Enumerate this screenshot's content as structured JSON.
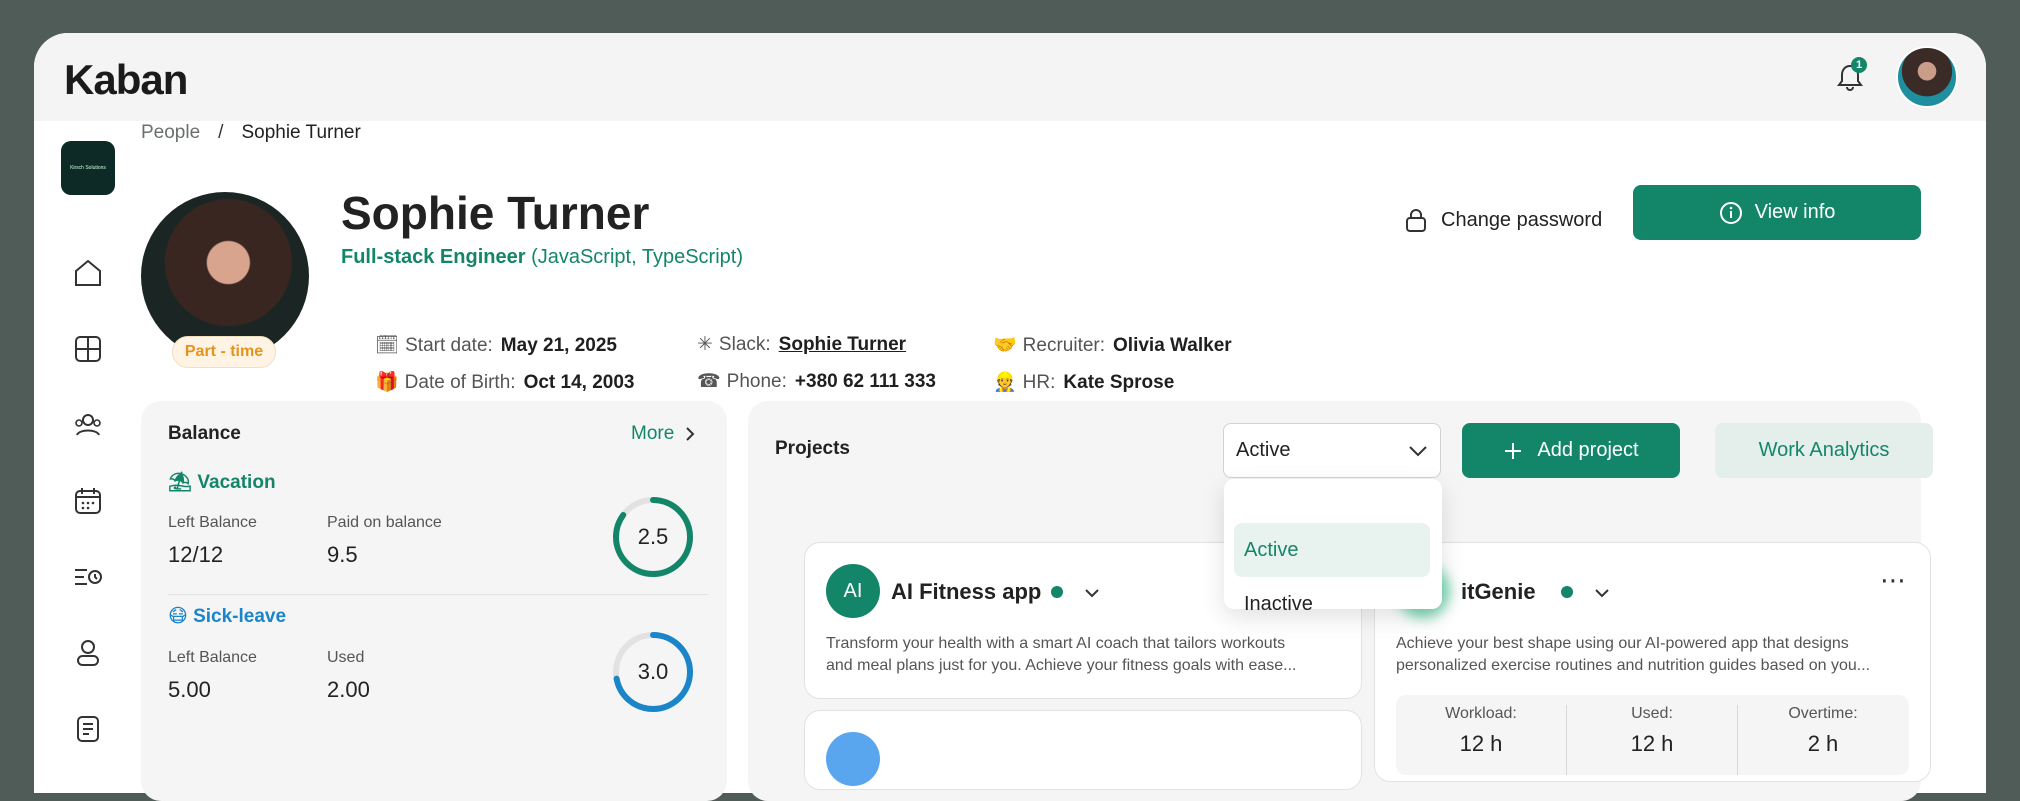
{
  "app": {
    "logo": "Kaban",
    "notifications_count": "1"
  },
  "breadcrumb": {
    "parent": "People",
    "separator": "/",
    "current": "Sophie Turner"
  },
  "profile": {
    "name": "Sophie Turner",
    "role_main": "Full-stack Engineer",
    "role_sub": "(JavaScript, TypeScript)",
    "employment_badge": "Part - time",
    "start_date_label": "Start date:",
    "start_date": "May 21, 2025",
    "dob_label": "Date of Birth:",
    "dob": "Oct 14, 2003",
    "slack_label": "Slack:",
    "slack": "Sophie Turner",
    "phone_label": "Phone:",
    "phone": "+380 62 111 333",
    "recruiter_label": "Recruiter:",
    "recruiter": "Olivia Walker",
    "hr_label": "HR:",
    "hr": "Kate Sprose"
  },
  "actions": {
    "change_password": "Change password",
    "view_info": "View info"
  },
  "balance": {
    "title": "Balance",
    "more": "More",
    "vacation": {
      "title": "Vacation",
      "left_label": "Left Balance",
      "left_value": "12/12",
      "paid_label": "Paid on balance",
      "paid_value": "9.5",
      "ring_value": "2.5",
      "ring_fraction": 0.85
    },
    "sick_leave": {
      "title": "Sick-leave",
      "left_label": "Left Balance",
      "left_value": "5.00",
      "used_label": "Used",
      "used_value": "2.00",
      "ring_value": "3.0",
      "ring_fraction": 0.72
    }
  },
  "projects": {
    "title": "Projects",
    "filter_value": "Active",
    "filter_options": [
      "Active",
      "Inactive"
    ],
    "add_label": "Add project",
    "analytics_label": "Work Analytics",
    "cards": [
      {
        "initials": "AI",
        "name": "AI Fitness app",
        "desc_1": "Transform your health with a smart AI coach that tailors workouts",
        "desc_2": "and meal plans just for you. Achieve your fitness goals with ease..."
      },
      {
        "initials": "",
        "name": "itGenie",
        "desc_1": "Achieve your best shape using our AI-powered app that designs",
        "desc_2": "personalized exercise routines and nutrition guides based on you..."
      }
    ],
    "stats": {
      "workload_label": "Workload:",
      "workload_value": "12 h",
      "used_label": "Used:",
      "used_value": "12 h",
      "overtime_label": "Overtime:",
      "overtime_value": "2 h"
    }
  },
  "colors": {
    "accent": "#13866a",
    "sick": "#1a85c9",
    "badge": "#e6931d"
  }
}
